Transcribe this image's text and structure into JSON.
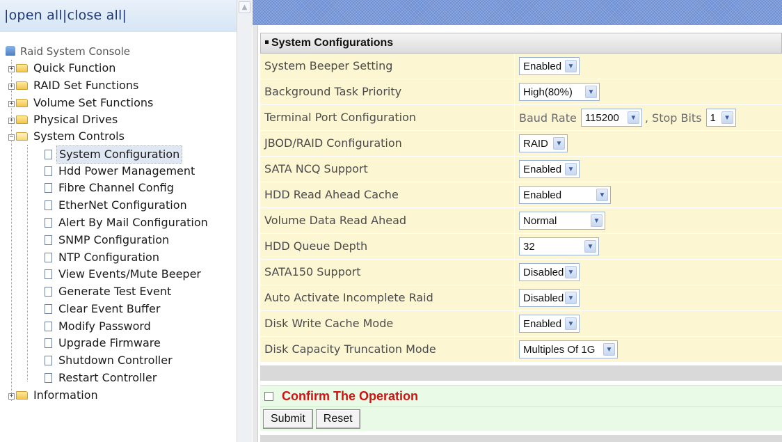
{
  "left": {
    "open_all": "open all",
    "close_all": "close all",
    "pipe": "|",
    "root": "Raid System Console",
    "tree": [
      {
        "label": "Quick Function"
      },
      {
        "label": "RAID Set Functions"
      },
      {
        "label": "Volume Set Functions"
      },
      {
        "label": "Physical Drives"
      },
      {
        "label": "System Controls"
      },
      {
        "label": "System Configuration"
      },
      {
        "label": "Hdd Power Management"
      },
      {
        "label": "Fibre Channel Config"
      },
      {
        "label": "EtherNet Configuration"
      },
      {
        "label": "Alert By Mail Configuration"
      },
      {
        "label": "SNMP Configuration"
      },
      {
        "label": "NTP Configuration"
      },
      {
        "label": "View Events/Mute Beeper"
      },
      {
        "label": "Generate Test Event"
      },
      {
        "label": "Clear Event Buffer"
      },
      {
        "label": "Modify Password"
      },
      {
        "label": "Upgrade Firmware"
      },
      {
        "label": "Shutdown Controller"
      },
      {
        "label": "Restart Controller"
      },
      {
        "label": "Information"
      }
    ]
  },
  "main": {
    "section_title": "System Configurations",
    "rows": [
      {
        "label": "System Beeper Setting",
        "value": "Enabled"
      },
      {
        "label": "Background Task Priority",
        "value": "High(80%)"
      },
      {
        "label": "Terminal Port Configuration",
        "baud_label": "Baud Rate",
        "baud_value": "115200",
        "stop_label": ", Stop Bits",
        "stop_value": "1"
      },
      {
        "label": "JBOD/RAID Configuration",
        "value": "RAID"
      },
      {
        "label": "SATA NCQ Support",
        "value": "Enabled"
      },
      {
        "label": "HDD Read Ahead Cache",
        "value": "Enabled"
      },
      {
        "label": "Volume Data Read Ahead",
        "value": "Normal"
      },
      {
        "label": "HDD Queue Depth",
        "value": "32"
      },
      {
        "label": "SATA150 Support",
        "value": "Disabled"
      },
      {
        "label": "Auto Activate Incomplete Raid",
        "value": "Disabled"
      },
      {
        "label": "Disk Write Cache Mode",
        "value": "Enabled"
      },
      {
        "label": "Disk Capacity Truncation Mode",
        "value": "Multiples Of 1G"
      }
    ],
    "confirm_label": "Confirm The Operation",
    "submit_label": "Submit",
    "reset_label": "Reset"
  }
}
